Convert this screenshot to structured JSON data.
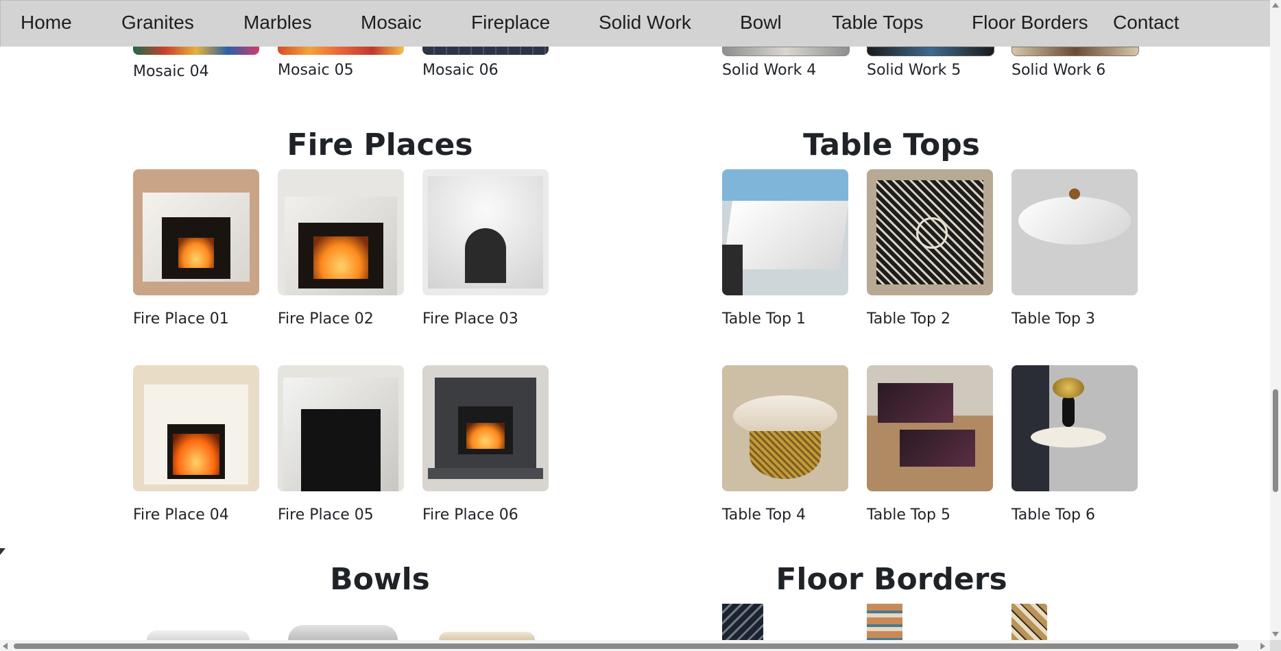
{
  "nav": {
    "items": [
      "Home",
      "Granites",
      "Marbles",
      "Mosaic",
      "Fireplace",
      "Solid Work",
      "Bowl",
      "Table Tops",
      "Floor Borders",
      "Contact"
    ]
  },
  "mosaic": {
    "items": [
      {
        "caption": "Mosaic 04"
      },
      {
        "caption": "Mosaic 05"
      },
      {
        "caption": "Mosaic 06"
      }
    ]
  },
  "solid_work": {
    "items": [
      {
        "caption": "Solid Work 4"
      },
      {
        "caption": "Solid Work 5"
      },
      {
        "caption": "Solid Work 6"
      }
    ]
  },
  "fire_places": {
    "title": "Fire Places",
    "items": [
      {
        "caption": "Fire Place 01"
      },
      {
        "caption": "Fire Place 02"
      },
      {
        "caption": "Fire Place 03"
      },
      {
        "caption": "Fire Place 04"
      },
      {
        "caption": "Fire Place 05"
      },
      {
        "caption": "Fire Place 06"
      }
    ]
  },
  "table_tops": {
    "title": "Table Tops",
    "items": [
      {
        "caption": "Table Top 1"
      },
      {
        "caption": "Table Top 2"
      },
      {
        "caption": "Table Top 3"
      },
      {
        "caption": "Table Top 4"
      },
      {
        "caption": "Table Top 5"
      },
      {
        "caption": "Table Top 6"
      }
    ]
  },
  "bowls": {
    "title": "Bowls"
  },
  "floor_borders": {
    "title": "Floor Borders"
  }
}
